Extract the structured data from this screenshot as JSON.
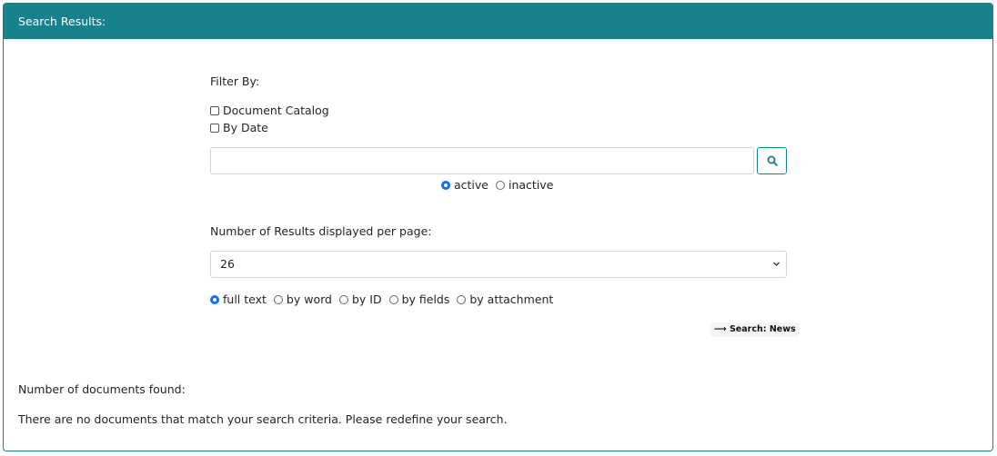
{
  "header": {
    "title": "Search Results:"
  },
  "filter": {
    "label": "Filter By:",
    "options": [
      {
        "label": "Document Catalog",
        "checked": false
      },
      {
        "label": "By Date",
        "checked": false
      }
    ]
  },
  "search": {
    "value": "",
    "button_icon": "search-icon",
    "status_options": [
      {
        "label": "active",
        "checked": true
      },
      {
        "label": "inactive",
        "checked": false
      }
    ]
  },
  "results_per_page": {
    "label": "Number of Results displayed per page:",
    "selected": "26"
  },
  "search_modes": [
    {
      "label": "full text",
      "checked": true
    },
    {
      "label": "by word",
      "checked": false
    },
    {
      "label": "by ID",
      "checked": false
    },
    {
      "label": "by fields",
      "checked": false
    },
    {
      "label": "by attachment",
      "checked": false
    }
  ],
  "action": {
    "arrow": "⟶",
    "label": "Search: News"
  },
  "results": {
    "count_label": "Number of documents found:",
    "message": "There are no documents that match your search criteria. Please redefine your search."
  },
  "colors": {
    "accent": "#17828e",
    "radio_checked": "#0d6efd"
  }
}
